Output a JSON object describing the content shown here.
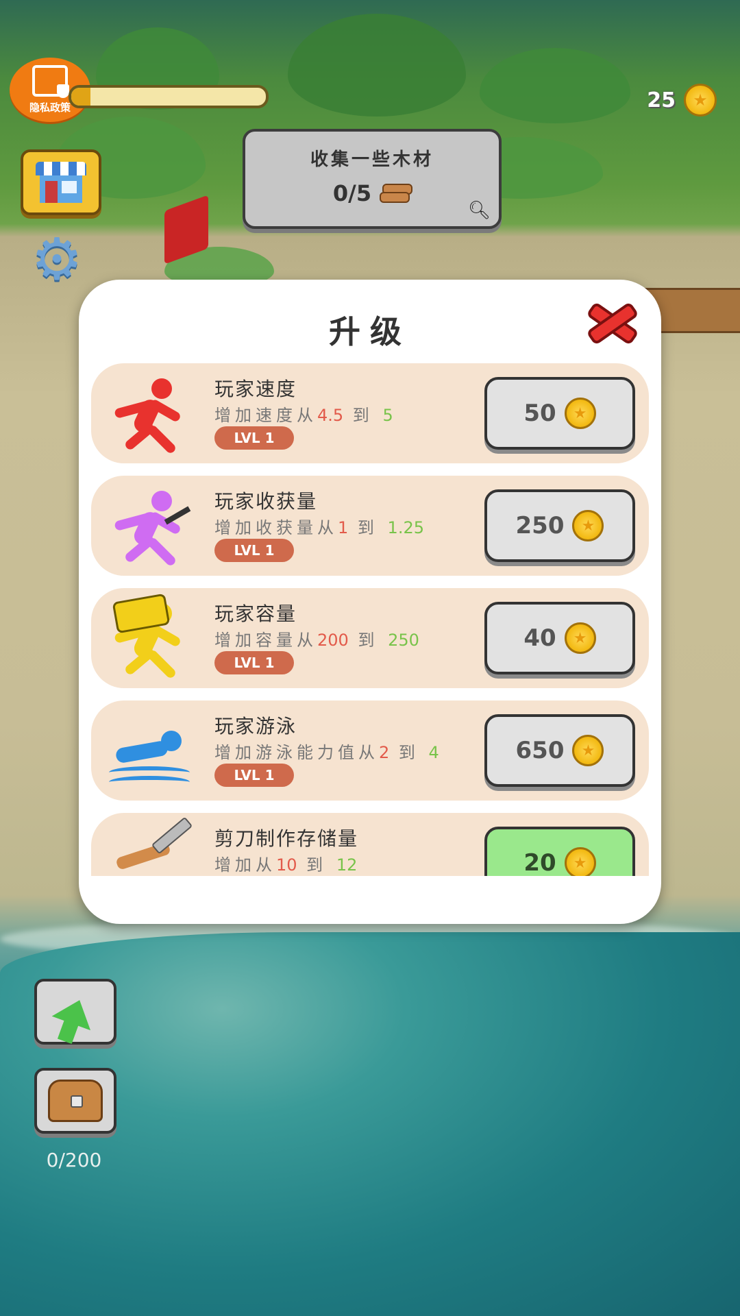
{
  "hud": {
    "privacy_label": "隐私政策",
    "progress_fraction": 0.1,
    "coin_count": "25"
  },
  "quest": {
    "title": "收集一些木材",
    "progress": "0/5"
  },
  "modal": {
    "title": "升级",
    "items": [
      {
        "name": "玩家速度",
        "desc_prefix": "增加速度从",
        "from": "4.5",
        "joiner": " 到 ",
        "to": "5",
        "level": "LVL 1",
        "price": "50",
        "icon": "running-figure-icon",
        "color": "#e8322e"
      },
      {
        "name": "玩家收获量",
        "desc_prefix": "增加收获量从",
        "from": "1",
        "joiner": " 到 ",
        "to": "1.25",
        "level": "LVL 1",
        "price": "250",
        "icon": "mining-figure-icon",
        "color": "#cf6cf2"
      },
      {
        "name": "玩家容量",
        "desc_prefix": "增加容量从",
        "from": "200",
        "joiner": " 到 ",
        "to": "250",
        "level": "LVL 1",
        "price": "40",
        "icon": "carrying-figure-icon",
        "color": "#f2cf1a"
      },
      {
        "name": "玩家游泳",
        "desc_prefix": "增加游泳能力值从",
        "from": "2",
        "joiner": " 到 ",
        "to": "4",
        "level": "LVL 1",
        "price": "650",
        "icon": "swimming-figure-icon",
        "color": "#2f8fe0"
      },
      {
        "name": "剪刀制作存储量",
        "desc_prefix": "增加从",
        "from": "10",
        "joiner": " 到 ",
        "to": "12",
        "level": "",
        "price": "20",
        "icon": "shears-icon",
        "color": "#d28b4a"
      }
    ]
  },
  "bag": {
    "count": "0/200"
  }
}
